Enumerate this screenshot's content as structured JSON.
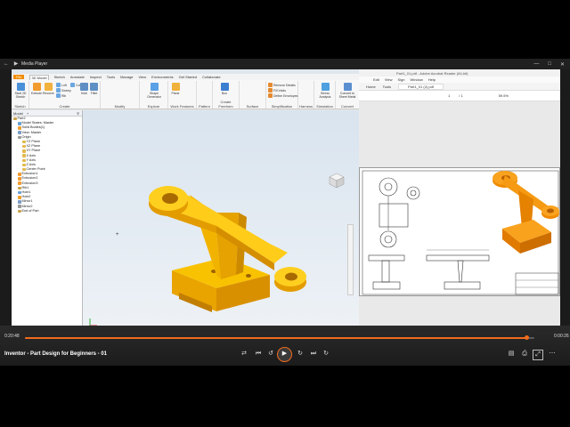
{
  "player": {
    "app_title": "Media Player",
    "video_title": "Inventor - Part Design for Beginners - 01",
    "time_elapsed": "0:20:48",
    "time_remaining": "0:00:26",
    "progress": 0.986,
    "accent": "#f26b1d",
    "controls": [
      "shuffle-icon",
      "previous-icon",
      "rewind-10-icon",
      "play-icon",
      "forward-30-icon",
      "next-icon",
      "repeat-icon"
    ],
    "right_controls": [
      "captions-icon",
      "cast-icon",
      "volume-icon",
      "fullscreen-icon",
      "more-icon"
    ]
  },
  "inventor": {
    "file_tab": "File",
    "tabs": [
      "3D Model",
      "Sketch",
      "Annotate",
      "Inspect",
      "Tools",
      "Manage",
      "View",
      "Environments",
      "Get Started",
      "Collaborate"
    ],
    "active_tab": "3D Model",
    "groups": [
      {
        "label": "Sketch",
        "buttons": [
          "Start 2D Sketch"
        ]
      },
      {
        "label": "Create",
        "buttons": [
          "Extrude",
          "Revolve",
          "Loft",
          "Sweep",
          "Rib",
          "Coil",
          "Hole",
          "Fillet"
        ]
      },
      {
        "label": "Modify",
        "buttons": []
      },
      {
        "label": "Explore",
        "buttons": [
          "Shape Generator"
        ]
      },
      {
        "label": "Work Features",
        "buttons": [
          "Plane"
        ]
      },
      {
        "label": "Pattern",
        "buttons": []
      },
      {
        "label": "Create Freeform",
        "buttons": [
          "Box"
        ]
      },
      {
        "label": "Surface",
        "buttons": []
      },
      {
        "label": "Simplification",
        "buttons": [
          "Remove Details",
          "Fill Voids",
          "Define Envelopes"
        ]
      },
      {
        "label": "Harness",
        "buttons": []
      },
      {
        "label": "Simulation",
        "buttons": [
          "Stress Analysis"
        ]
      },
      {
        "label": "Convert",
        "buttons": [
          "Convert to Sheet Metal"
        ]
      }
    ],
    "browser_tabs": [
      "Model",
      "+"
    ],
    "tree": [
      {
        "label": "Part2",
        "level": 0
      },
      {
        "label": "Model States: Master",
        "level": 1
      },
      {
        "label": "Solid Bodies(1)",
        "level": 1
      },
      {
        "label": "View: Master",
        "level": 1
      },
      {
        "label": "Origin",
        "level": 1
      },
      {
        "label": "YZ Plane",
        "level": 2
      },
      {
        "label": "XZ Plane",
        "level": 2
      },
      {
        "label": "XY Plane",
        "level": 2
      },
      {
        "label": "X Axis",
        "level": 2
      },
      {
        "label": "Y Axis",
        "level": 2
      },
      {
        "label": "Z Axis",
        "level": 2
      },
      {
        "label": "Center Point",
        "level": 2
      },
      {
        "label": "Extrusion1",
        "level": 1
      },
      {
        "label": "Extrusion2",
        "level": 1
      },
      {
        "label": "Extrusion3",
        "level": 1
      },
      {
        "label": "Rib1",
        "level": 1
      },
      {
        "label": "Hole1",
        "level": 1
      },
      {
        "label": "Hole2",
        "level": 1
      },
      {
        "label": "Mirror1",
        "level": 1
      },
      {
        "label": "Mirror2",
        "level": 1
      },
      {
        "label": "End of Part",
        "level": 1
      }
    ],
    "model_color": "#f5b400"
  },
  "pdf": {
    "window_title": "Part1_01.pdf - Adobe Acrobat Reader (64-bit)",
    "menu": [
      "Edit",
      "View",
      "Sign",
      "Window",
      "Help"
    ],
    "tabs": [
      "Home",
      "Tools",
      "Part1_01 (2).pdf"
    ],
    "page_current": "1",
    "page_total": "/ 1",
    "zoom": "59.5%"
  }
}
